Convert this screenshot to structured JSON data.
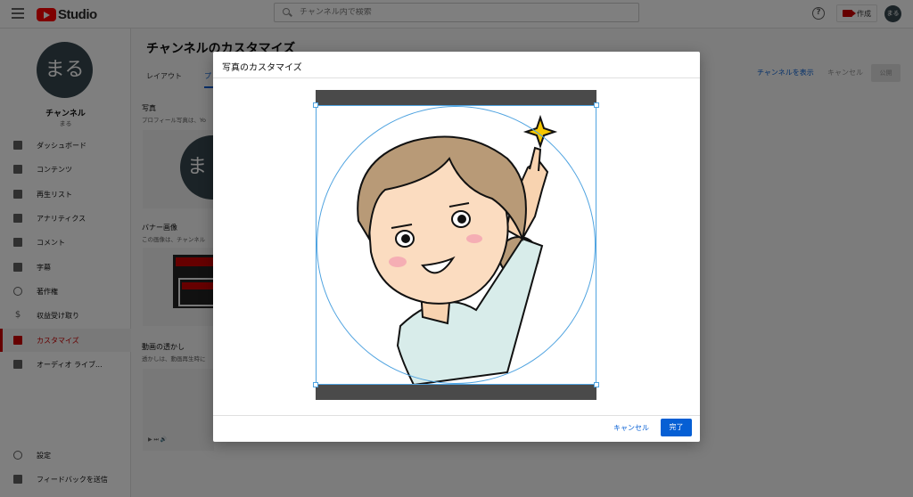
{
  "header": {
    "brand": "Studio",
    "search_placeholder": "チャンネル内で検索",
    "help_glyph": "?",
    "create_label": "作成",
    "avatar_text": "まる"
  },
  "sidebar": {
    "avatar_text": "まる",
    "channel_name": "チャンネル",
    "channel_handle": "まる",
    "items": [
      {
        "label": "ダッシュボード",
        "icon": "dashboard-icon"
      },
      {
        "label": "コンテンツ",
        "icon": "content-icon"
      },
      {
        "label": "再生リスト",
        "icon": "playlist-icon"
      },
      {
        "label": "アナリティクス",
        "icon": "analytics-icon"
      },
      {
        "label": "コメント",
        "icon": "comment-icon"
      },
      {
        "label": "字幕",
        "icon": "subtitles-icon"
      },
      {
        "label": "著作権",
        "icon": "copyright-icon"
      },
      {
        "label": "収益受け取り",
        "icon": "dollar-icon"
      },
      {
        "label": "カスタマイズ",
        "icon": "magic-wand-icon"
      },
      {
        "label": "オーディオ ライブ...",
        "icon": "audio-library-icon"
      }
    ],
    "active_item": "カスタマイズ",
    "bottom_items": [
      {
        "label": "設定",
        "icon": "gear-icon"
      },
      {
        "label": "フィードバックを送信",
        "icon": "feedback-icon"
      }
    ]
  },
  "main": {
    "title": "チャンネルのカスタマイズ",
    "tabs": [
      {
        "label": "レイアウト"
      },
      {
        "label": "プ"
      }
    ],
    "view_channel": "チャンネルを表示",
    "cancel": "キャンセル",
    "publish": "公開",
    "photo_title": "写真",
    "photo_desc": "プロフィール写真は、Yo",
    "photo_avatar_text": "ま",
    "banner_title": "バナー画像",
    "banner_desc": "この画像は、チャンネル",
    "watermark_title": "動画の透かし",
    "watermark_desc": "透かしは、動画再生時に"
  },
  "dialog": {
    "title": "写真のカスタマイズ",
    "cancel_label": "キャンセル",
    "done_label": "完了"
  },
  "colors": {
    "accent_blue": "#065fd4",
    "brand_red": "#ff0000",
    "crop_guide": "#4fa3e0",
    "avatar_bg": "#37474f"
  }
}
